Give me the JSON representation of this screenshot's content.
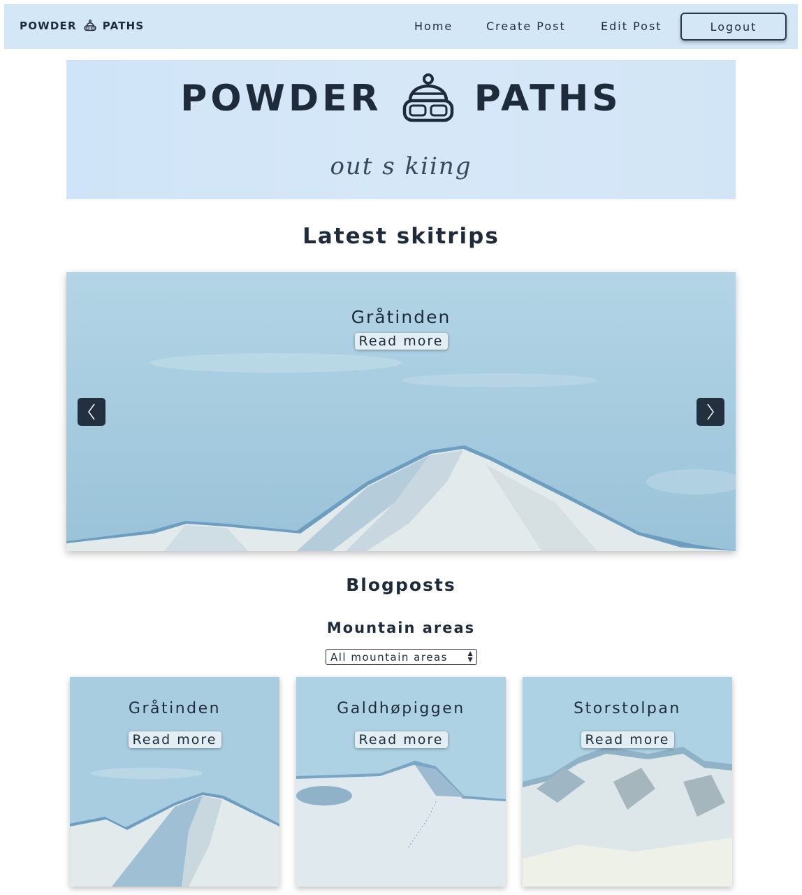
{
  "navbar": {
    "brand_left": "POWDER",
    "brand_right": "PATHS",
    "brand_icon": "ski-helmet-goggles-icon",
    "links": [
      "Home",
      "Create Post",
      "Edit Post"
    ],
    "logout": "Logout"
  },
  "hero": {
    "title_left": "POWDER",
    "title_right": "PATHS",
    "tagline": "out s kiing",
    "icon": "ski-helmet-goggles-icon"
  },
  "latest": {
    "heading": "Latest skitrips",
    "slide_title": "Gråtinden",
    "read_more": "Read more",
    "prev_icon": "chevron-left-icon",
    "next_icon": "chevron-right-icon"
  },
  "blog": {
    "heading": "Blogposts",
    "filter_heading": "Mountain areas",
    "filter_selected": "All mountain areas",
    "cards": [
      {
        "title": "Gråtinden",
        "read_more": "Read more"
      },
      {
        "title": "Galdhøpiggen",
        "read_more": "Read more"
      },
      {
        "title": "Storstolpan",
        "read_more": "Read more"
      }
    ]
  },
  "colors": {
    "navbar_bg": "#d3e7f7",
    "text_dark": "#1e2b3a",
    "sky": "#a9cde0",
    "snow": "#e4ebee"
  }
}
